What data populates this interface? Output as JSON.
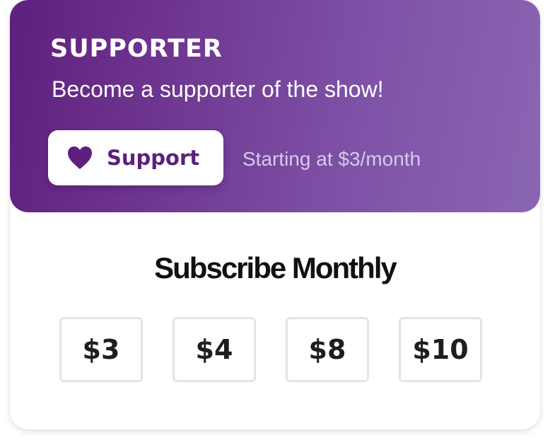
{
  "tier": {
    "title": "SUPPORTER",
    "subtitle": "Become a supporter of the show!",
    "support_button_label": "Support",
    "support_icon": "heart-icon",
    "price_note": "Starting at $3/month"
  },
  "subscribe": {
    "title": "Subscribe Monthly",
    "amounts": [
      "$3",
      "$4",
      "$8",
      "$10"
    ]
  },
  "colors": {
    "brand_purple": "#5e1f7e",
    "gradient_end": "#8a66b2",
    "note_text": "#d9c9ea",
    "amount_border": "#e3e5e8"
  }
}
